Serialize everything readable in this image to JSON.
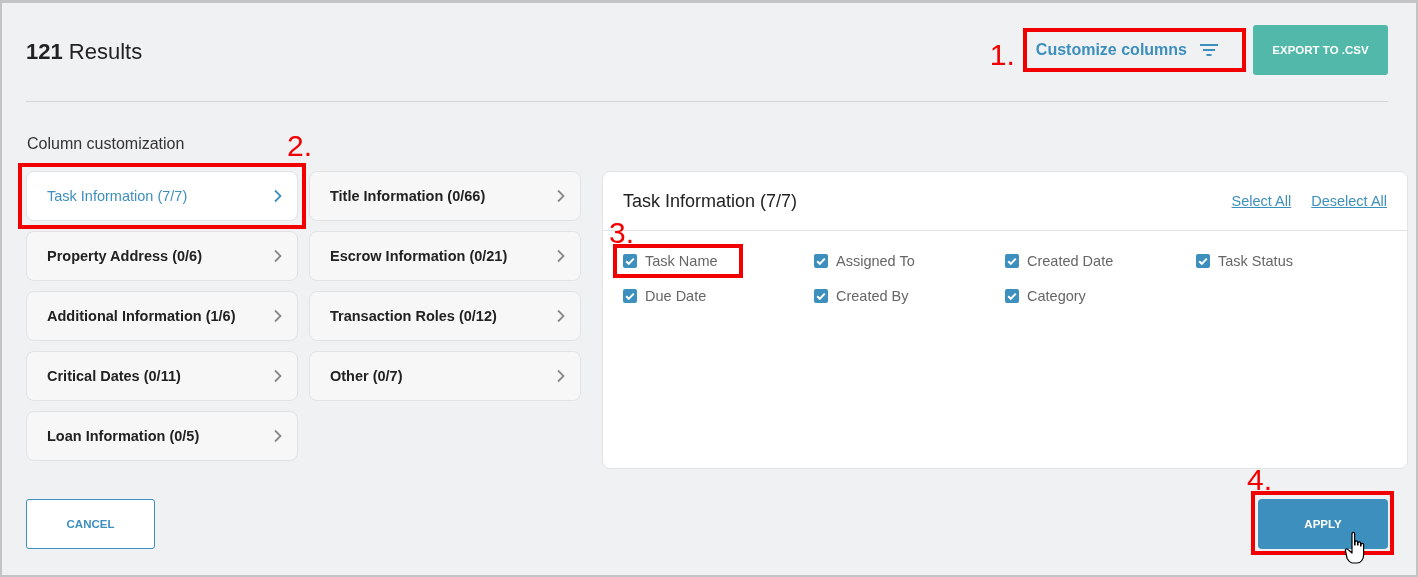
{
  "results": {
    "count": "121",
    "label": "Results"
  },
  "customize_button": {
    "label": "Customize columns",
    "callout": {
      "number": "1."
    }
  },
  "export_button": {
    "label": "EXPORT TO .CSV"
  },
  "section_title": "Column customization",
  "categories": [
    {
      "label": "Task Information (7/7)",
      "selected": true,
      "callout": {
        "number": "2."
      }
    },
    {
      "label": "Title Information (0/66)",
      "selected": false
    },
    {
      "label": "Property Address (0/6)",
      "selected": false
    },
    {
      "label": "Escrow Information (0/21)",
      "selected": false
    },
    {
      "label": "Additional Information (1/6)",
      "selected": false
    },
    {
      "label": "Transaction Roles (0/12)",
      "selected": false
    },
    {
      "label": "Critical Dates (0/11)",
      "selected": false
    },
    {
      "label": "Other (0/7)",
      "selected": false
    },
    {
      "label": "Loan Information (0/5)",
      "selected": false
    }
  ],
  "panel": {
    "title": "Task Information (7/7)",
    "links": [
      "Select All",
      "Deselect All"
    ],
    "fields": [
      {
        "label": "Task Name",
        "checked": true,
        "callout": {
          "number": "3."
        }
      },
      {
        "label": "Assigned To",
        "checked": true
      },
      {
        "label": "Created Date",
        "checked": true
      },
      {
        "label": "Task Status",
        "checked": true
      },
      {
        "label": "Due Date",
        "checked": true
      },
      {
        "label": "Created By",
        "checked": true
      },
      {
        "label": "Category",
        "checked": true
      }
    ]
  },
  "cancel_button": {
    "label": "CANCEL"
  },
  "apply_button": {
    "label": "APPLY",
    "callout": {
      "number": "4."
    }
  }
}
